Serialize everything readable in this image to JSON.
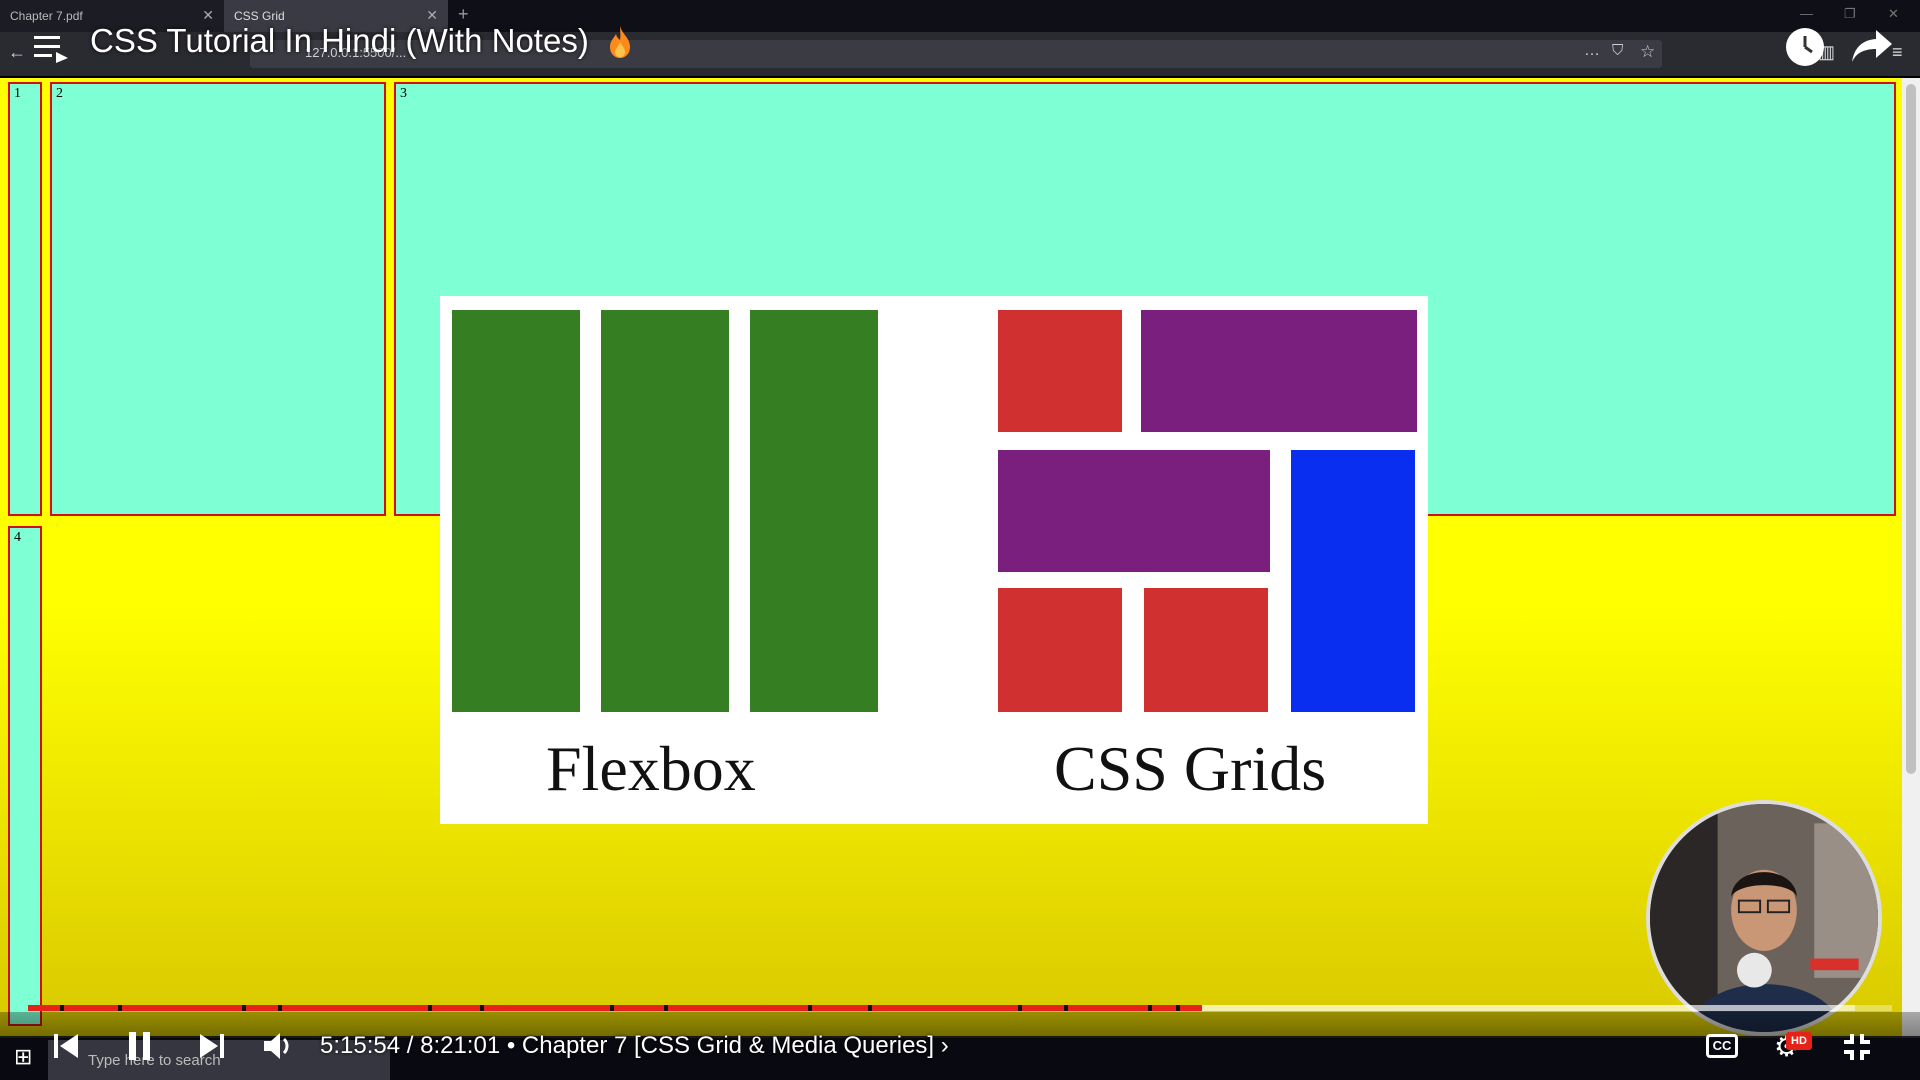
{
  "browser": {
    "tabs": [
      {
        "label": "Chapter 7.pdf"
      },
      {
        "label": "CSS Grid"
      }
    ],
    "new_tab_symbol": "+",
    "address_text": "127.0.0.1:5500/...",
    "overflow_icon": "…"
  },
  "video": {
    "title": "CSS Tutorial In Hindi (With Notes)",
    "time_current": "5:15:54",
    "time_total": "8:21:01",
    "chapter_separator": "•",
    "chapter_title": "Chapter 7 [CSS Grid & Media Queries]",
    "chapter_chevron": "›",
    "progress_played": 0.63,
    "progress_loaded": 0.98,
    "hd_badge": "HD",
    "cc_label": "CC"
  },
  "grid_cells": [
    {
      "number": "1"
    },
    {
      "number": "2"
    },
    {
      "number": "3"
    },
    {
      "number": "4"
    }
  ],
  "slide": {
    "left_label": "Flexbox",
    "right_label": "CSS Grids"
  },
  "taskbar": {
    "search_placeholder": "Type here to search"
  },
  "colors": {
    "page_background": "#ffff00",
    "grid_cell": "#7fffd4",
    "cell_border": "#d01010",
    "flex_green": "#367e22",
    "grid_red": "#d03030",
    "grid_purple": "#7a1f7d",
    "grid_blue": "#0a2ef0",
    "progress_red": "#e62117"
  }
}
